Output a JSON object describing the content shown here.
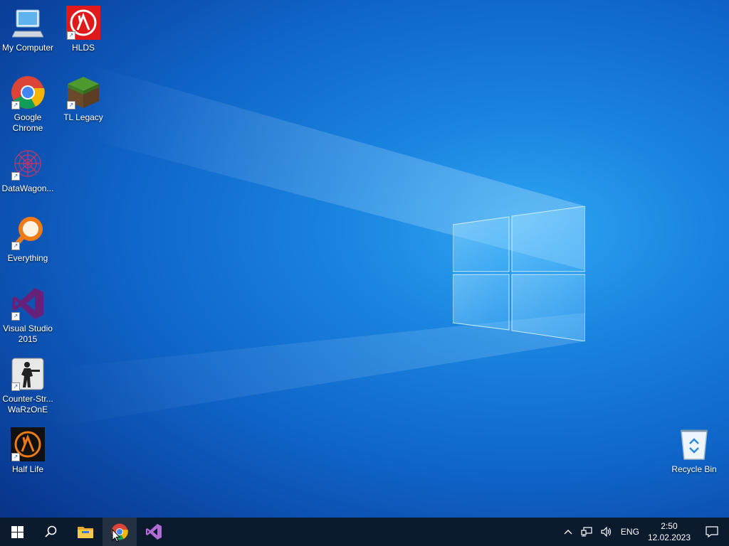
{
  "desktop": {
    "icons": [
      {
        "label": "My Computer",
        "icon": "computer-icon"
      },
      {
        "label": "HLDS",
        "icon": "half-life-icon"
      },
      {
        "label": "Google\nChrome",
        "icon": "chrome-icon"
      },
      {
        "label": "TL Legacy",
        "icon": "grass-block-icon"
      },
      {
        "label": "DataWagon...",
        "icon": "datawagon-icon"
      },
      {
        "label": "Everything",
        "icon": "magnifier-icon"
      },
      {
        "label": "Visual Studio\n2015",
        "icon": "visual-studio-icon"
      },
      {
        "label": "Counter-Str...\nWaRzOnE",
        "icon": "counter-strike-icon"
      },
      {
        "label": "Half Life",
        "icon": "half-life-icon"
      },
      {
        "label": "Recycle Bin",
        "icon": "recycle-bin-icon"
      }
    ]
  },
  "taskbar": {
    "buttons": [
      "start-icon",
      "search-icon",
      "file-explorer-icon",
      "chrome-icon",
      "visual-studio-icon"
    ],
    "tray": {
      "language": "ENG",
      "time": "2:50",
      "date": "12.02.2023"
    }
  },
  "colors": {
    "taskbar": "#0c1a2e",
    "wallpaper": "#1a84e0"
  }
}
